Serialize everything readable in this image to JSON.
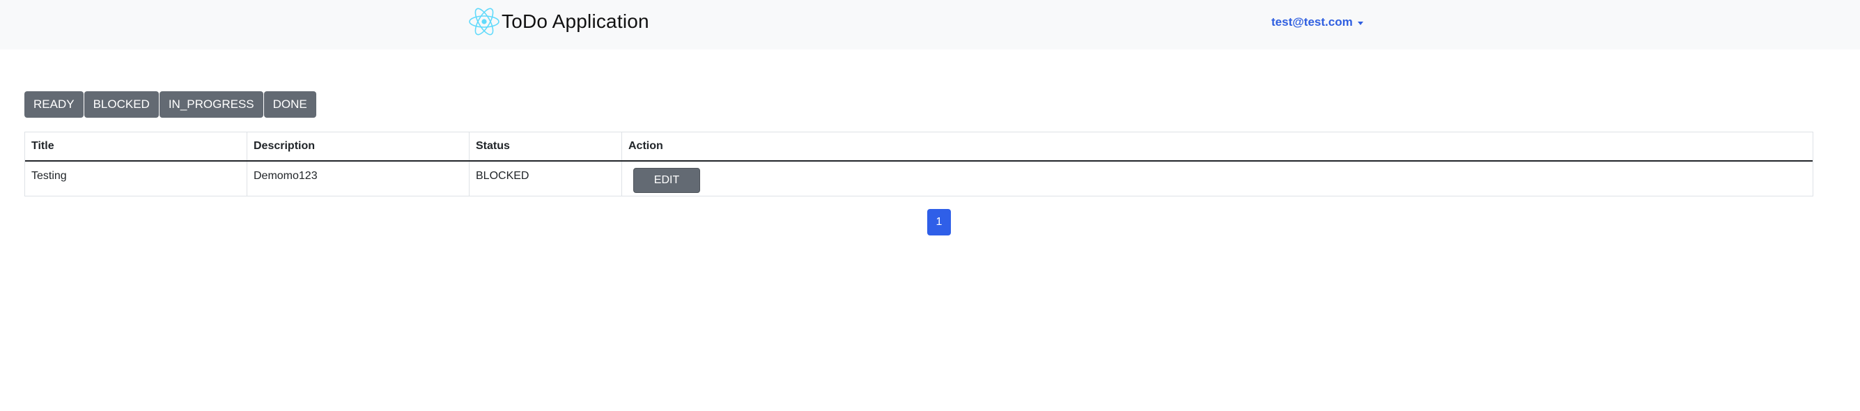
{
  "navbar": {
    "brand_title": "ToDo Application",
    "brand_icon": "react-atom-icon",
    "user_email": "test@test.com",
    "colors": {
      "background": "#f8f9fa",
      "user_link": "#2f5fe0",
      "logo": "#61dafb"
    }
  },
  "filters": {
    "buttons": [
      "READY",
      "BLOCKED",
      "IN_PROGRESS",
      "DONE"
    ],
    "color": "#636a73"
  },
  "table": {
    "headers": [
      "Title",
      "Description",
      "Status",
      "Action"
    ],
    "rows": [
      {
        "title": "Testing",
        "description": "Demomo123",
        "status": "BLOCKED",
        "action_label": "EDIT"
      }
    ]
  },
  "pagination": {
    "pages": [
      "1"
    ],
    "active_page": "1",
    "active_color": "#2f5fe8"
  }
}
